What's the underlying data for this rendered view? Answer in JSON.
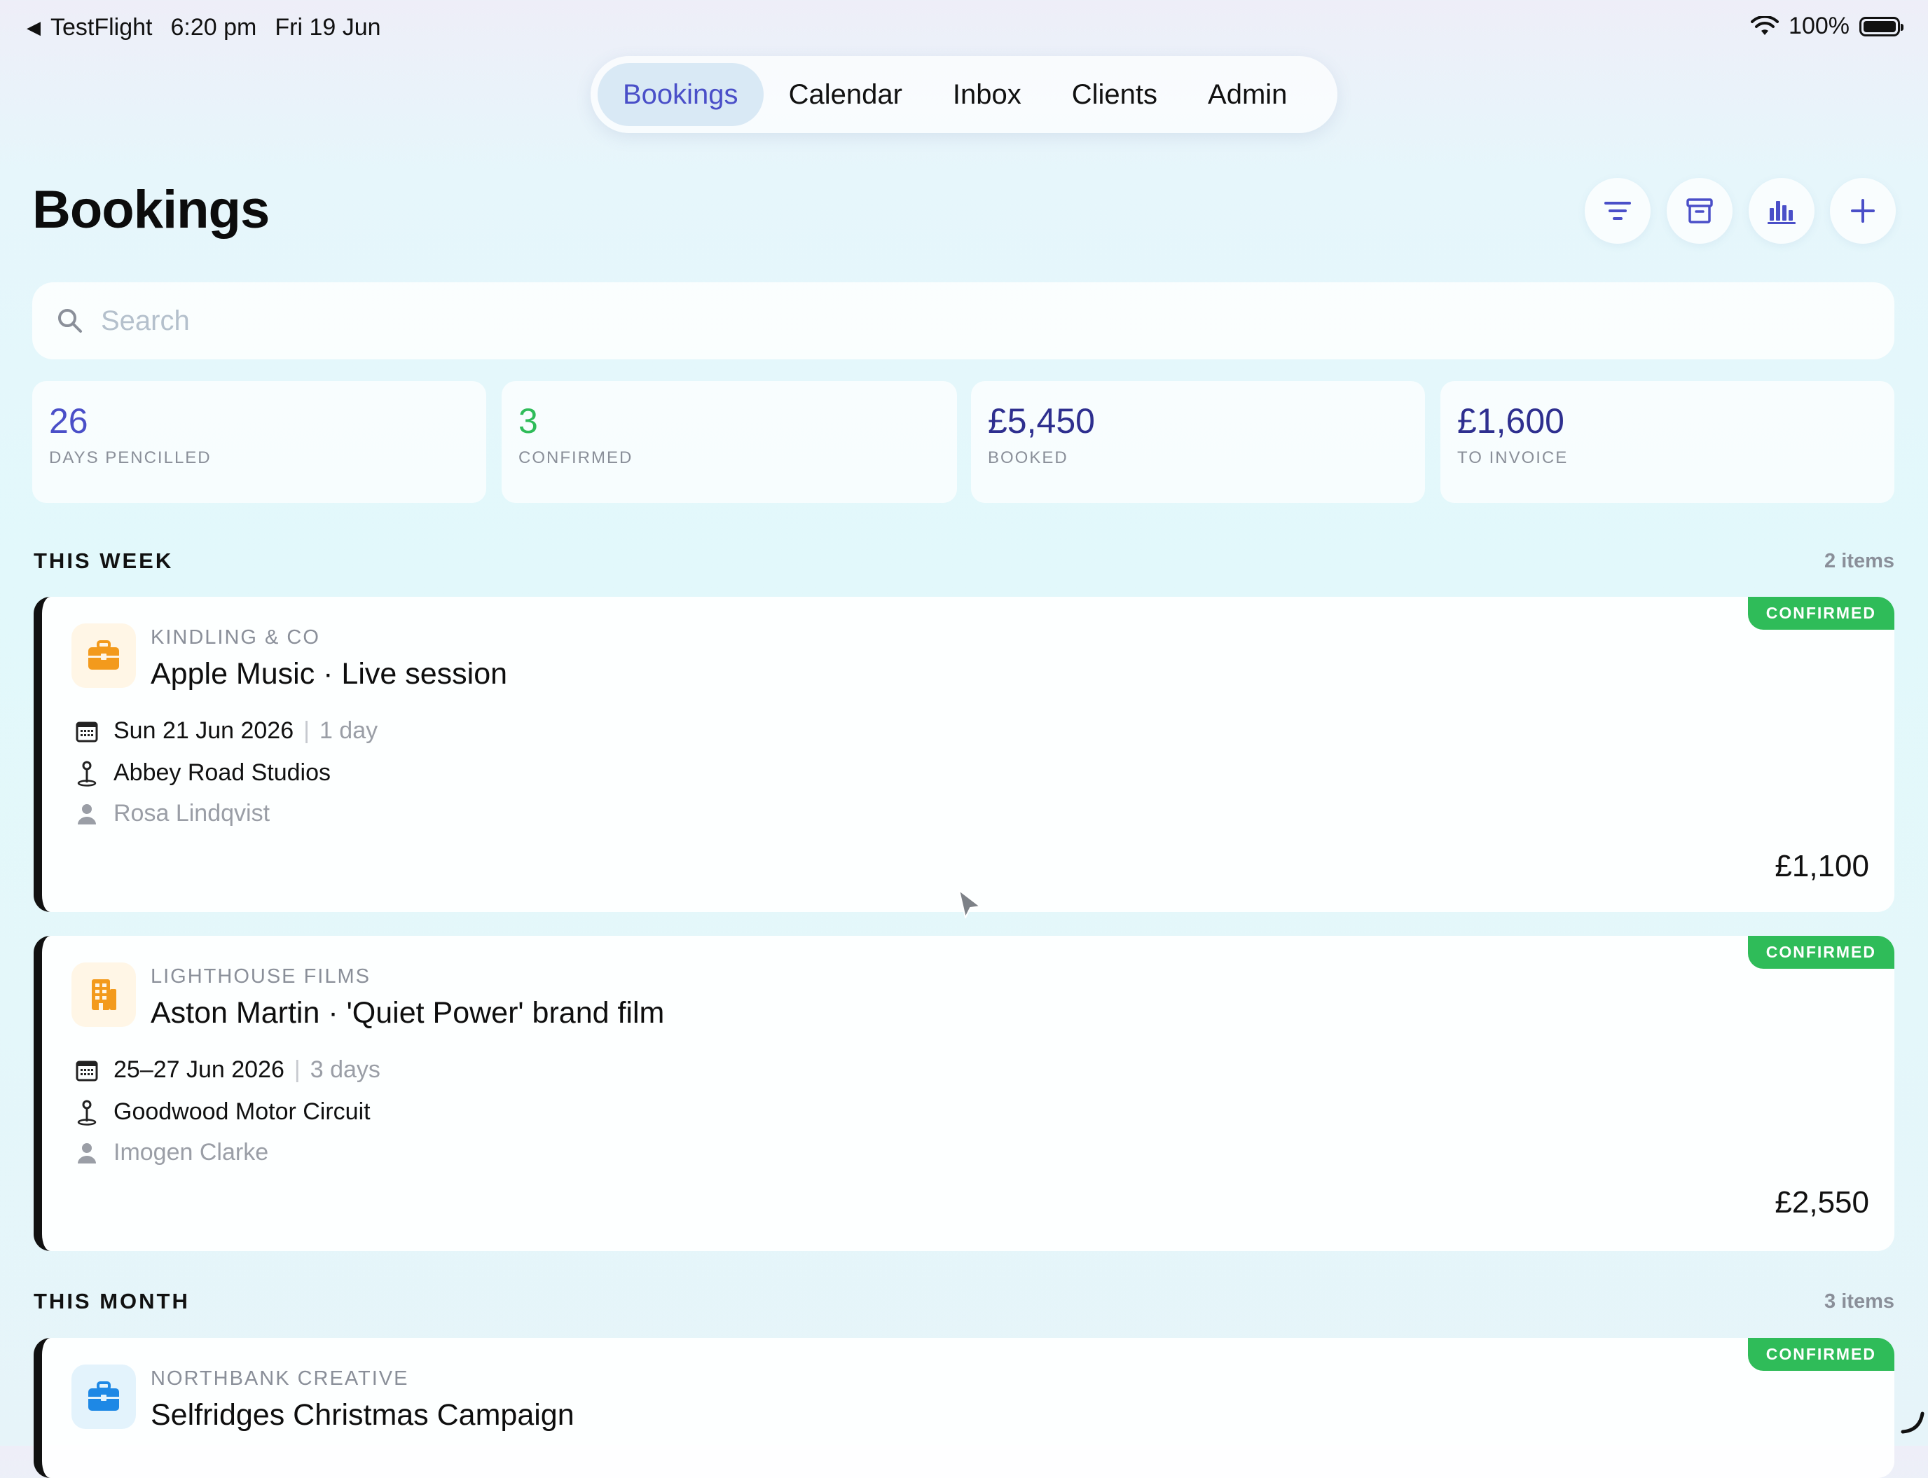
{
  "status_bar": {
    "back_app": "TestFlight",
    "time": "6:20 pm",
    "date": "Fri 19 Jun",
    "battery": "100%"
  },
  "nav": {
    "tabs": [
      {
        "label": "Bookings",
        "active": true
      },
      {
        "label": "Calendar",
        "active": false
      },
      {
        "label": "Inbox",
        "active": false
      },
      {
        "label": "Clients",
        "active": false
      },
      {
        "label": "Admin",
        "active": false
      }
    ]
  },
  "header": {
    "title": "Bookings",
    "actions": [
      "filter-icon",
      "archive-icon",
      "bar-chart-icon",
      "plus-icon"
    ]
  },
  "search": {
    "placeholder": "Search",
    "value": ""
  },
  "stats": [
    {
      "value": "26",
      "label": "DAYS PENCILLED",
      "color": "#4a4fc8"
    },
    {
      "value": "3",
      "label": "CONFIRMED",
      "color": "#2fbc59"
    },
    {
      "value": "£5,450",
      "label": "BOOKED",
      "color": "#2e2f8f"
    },
    {
      "value": "£1,600",
      "label": "TO INVOICE",
      "color": "#2e2f8f"
    }
  ],
  "sections": [
    {
      "title": "THIS WEEK",
      "count": "2 items",
      "bookings": [
        {
          "status": "CONFIRMED",
          "client": "KINDLING & CO",
          "title": "Apple Music · Live session",
          "icon": "briefcase-icon",
          "icon_color": "#f39a1c",
          "date": "Sun 21 Jun 2026",
          "duration": "1 day",
          "location": "Abbey Road Studios",
          "contact": "Rosa Lindqvist",
          "price": "£1,100"
        },
        {
          "status": "CONFIRMED",
          "client": "LIGHTHOUSE FILMS",
          "title": "Aston Martin · 'Quiet Power' brand film",
          "icon": "building-icon",
          "icon_color": "#f39a1c",
          "date": "25–27 Jun 2026",
          "duration": "3 days",
          "location": "Goodwood Motor Circuit",
          "contact": "Imogen Clarke",
          "price": "£2,550"
        }
      ]
    },
    {
      "title": "THIS MONTH",
      "count": "3 items",
      "bookings": [
        {
          "status": "CONFIRMED",
          "client": "NORTHBANK CREATIVE",
          "title": "Selfridges Christmas Campaign",
          "icon": "briefcase-icon",
          "icon_color": "#1e88e5"
        }
      ]
    }
  ]
}
